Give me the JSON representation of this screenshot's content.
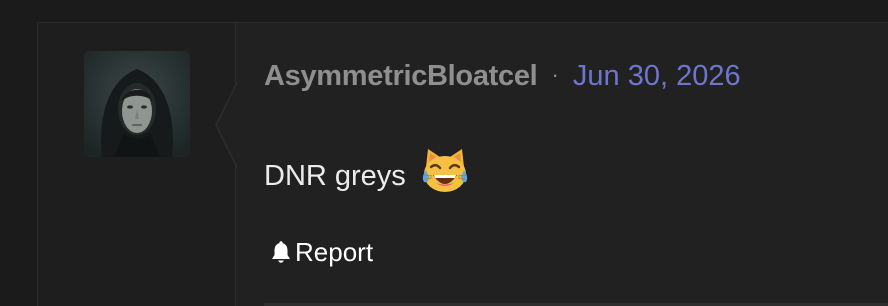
{
  "post": {
    "username": "AsymmetricBloatcel",
    "separator": "·",
    "date": "Jun 30, 2026",
    "message": "DNR greys",
    "emoji_icon": "joy-cat-icon",
    "actions": {
      "report_label": "Report",
      "report_icon": "bell-icon"
    }
  },
  "colors": {
    "page_background": "#1b1b1b",
    "post_background": "#212121",
    "username": "#8f8f8f",
    "date_link": "#6f75cc",
    "message_text": "#ececec"
  }
}
